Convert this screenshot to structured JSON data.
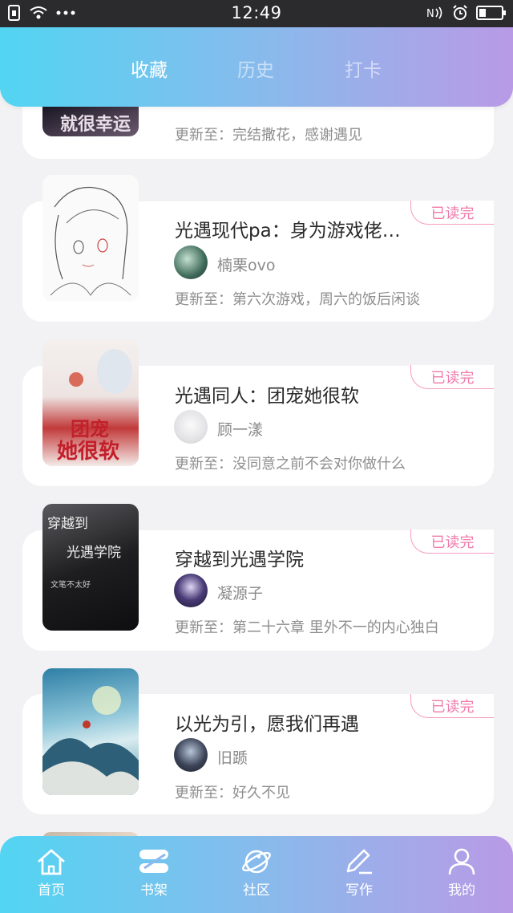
{
  "status_bar": {
    "time": "12:49"
  },
  "tabs": [
    {
      "label": "收藏",
      "active": true
    },
    {
      "label": "历史",
      "active": false
    },
    {
      "label": "打卡",
      "active": false
    }
  ],
  "books": [
    {
      "title": "",
      "author": "",
      "update_prefix": "更新至：",
      "update": "完结撒花，感谢遇见",
      "badge": ""
    },
    {
      "title": "光遇现代pa：身为游戏佬…",
      "author": "楠栗ovo",
      "update_prefix": "更新至：",
      "update": "第六次游戏，周六的饭后闲谈",
      "badge": "已读完"
    },
    {
      "title": "光遇同人：团宠她很软",
      "author": "顾一漾",
      "update_prefix": "更新至：",
      "update": "没同意之前不会对你做什么",
      "badge": "已读完",
      "cover_text": [
        "团宠",
        "她很软"
      ]
    },
    {
      "title": "穿越到光遇学院",
      "author": "凝源子",
      "update_prefix": "更新至：",
      "update": "第二十六章 里外不一的内心独白",
      "badge": "已读完",
      "cover_text": [
        "穿越到",
        "光遇学院",
        "文笔不太好"
      ]
    },
    {
      "title": "以光为引，愿我们再遇",
      "author": "旧踬",
      "update_prefix": "更新至：",
      "update": "好久不见",
      "badge": "已读完"
    }
  ],
  "bottom_nav": [
    {
      "label": "首页",
      "icon": "home-icon"
    },
    {
      "label": "书架",
      "icon": "bookshelf-icon"
    },
    {
      "label": "社区",
      "icon": "planet-icon"
    },
    {
      "label": "写作",
      "icon": "pen-icon"
    },
    {
      "label": "我的",
      "icon": "user-icon"
    }
  ],
  "colors": {
    "gradient_start": "#52d5f2",
    "gradient_end": "#b99ae6",
    "badge": "#f07aa8"
  }
}
